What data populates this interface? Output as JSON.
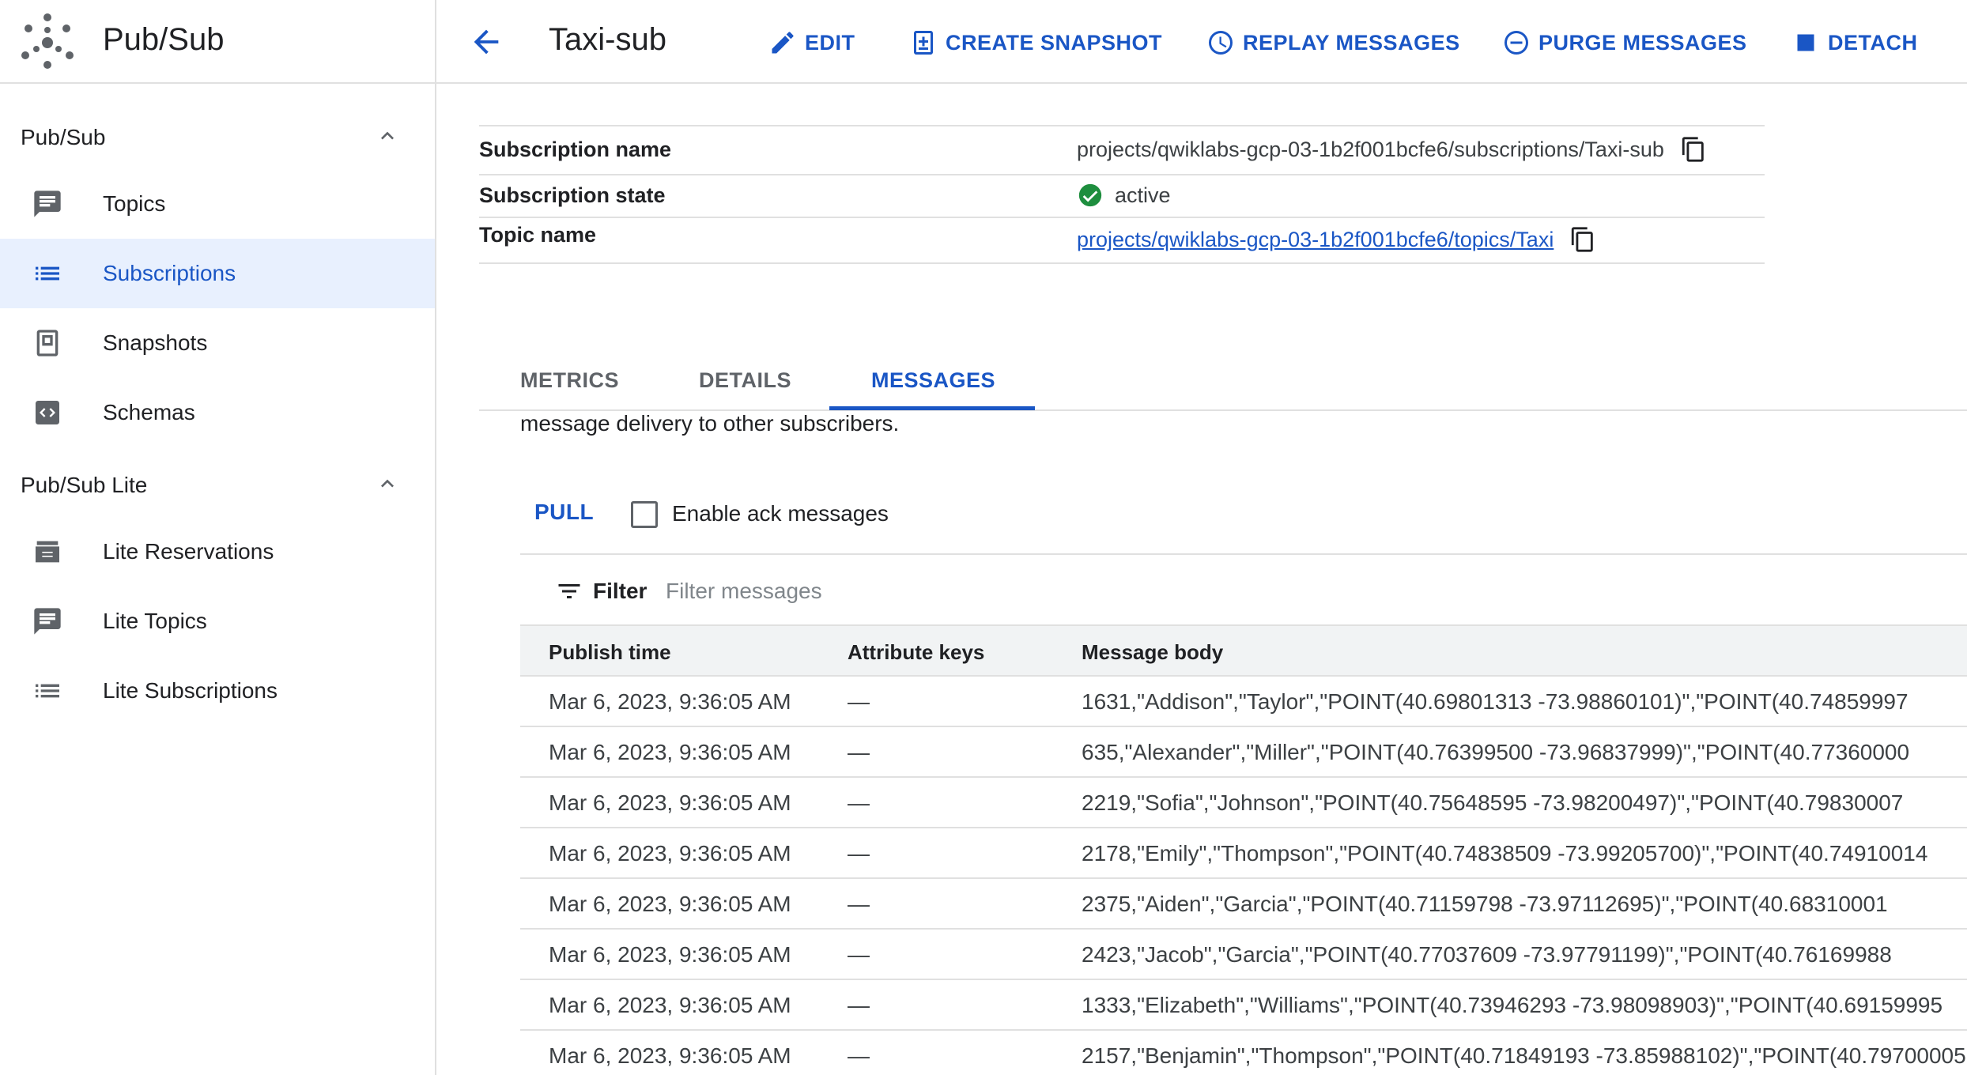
{
  "sidebar": {
    "product_title": "Pub/Sub",
    "sections": [
      {
        "label": "Pub/Sub",
        "items": [
          {
            "label": "Topics",
            "icon": "message-icon"
          },
          {
            "label": "Subscriptions",
            "icon": "list-icon",
            "active": true
          },
          {
            "label": "Snapshots",
            "icon": "snapshot-icon"
          },
          {
            "label": "Schemas",
            "icon": "schema-icon"
          }
        ]
      },
      {
        "label": "Pub/Sub Lite",
        "items": [
          {
            "label": "Lite Reservations",
            "icon": "reservation-icon"
          },
          {
            "label": "Lite Topics",
            "icon": "message-icon"
          },
          {
            "label": "Lite Subscriptions",
            "icon": "list-icon"
          }
        ]
      }
    ]
  },
  "header": {
    "title": "Taxi-sub",
    "actions": {
      "edit": "EDIT",
      "create_snapshot": "CREATE SNAPSHOT",
      "replay": "REPLAY MESSAGES",
      "purge": "PURGE MESSAGES",
      "detach": "DETACH"
    }
  },
  "info": {
    "subscription_name_label": "Subscription name",
    "subscription_name": "projects/qwiklabs-gcp-03-1b2f001bcfe6/subscriptions/Taxi-sub",
    "subscription_state_label": "Subscription state",
    "subscription_state": "active",
    "topic_name_label": "Topic name",
    "topic_name": "projects/qwiklabs-gcp-03-1b2f001bcfe6/topics/Taxi"
  },
  "tabs": {
    "metrics": "METRICS",
    "details": "DETAILS",
    "messages": "MESSAGES"
  },
  "messages_panel": {
    "description": "message delivery to other subscribers.",
    "pull_label": "PULL",
    "ack_label": "Enable ack messages",
    "filter_label": "Filter",
    "filter_placeholder": "Filter messages",
    "columns": {
      "publish_time": "Publish time",
      "attribute_keys": "Attribute keys",
      "message_body": "Message body"
    },
    "rows": [
      {
        "time": "Mar 6, 2023, 9:36:05 AM",
        "attrs": "—",
        "body": "1631,\"Addison\",\"Taylor\",\"POINT(40.69801313 -73.98860101)\",\"POINT(40.74859997"
      },
      {
        "time": "Mar 6, 2023, 9:36:05 AM",
        "attrs": "—",
        "body": "635,\"Alexander\",\"Miller\",\"POINT(40.76399500 -73.96837999)\",\"POINT(40.77360000"
      },
      {
        "time": "Mar 6, 2023, 9:36:05 AM",
        "attrs": "—",
        "body": "2219,\"Sofia\",\"Johnson\",\"POINT(40.75648595 -73.98200497)\",\"POINT(40.79830007"
      },
      {
        "time": "Mar 6, 2023, 9:36:05 AM",
        "attrs": "—",
        "body": "2178,\"Emily\",\"Thompson\",\"POINT(40.74838509 -73.99205700)\",\"POINT(40.74910014"
      },
      {
        "time": "Mar 6, 2023, 9:36:05 AM",
        "attrs": "—",
        "body": "2375,\"Aiden\",\"Garcia\",\"POINT(40.71159798 -73.97112695)\",\"POINT(40.68310001"
      },
      {
        "time": "Mar 6, 2023, 9:36:05 AM",
        "attrs": "—",
        "body": "2423,\"Jacob\",\"Garcia\",\"POINT(40.77037609 -73.97791199)\",\"POINT(40.76169988"
      },
      {
        "time": "Mar 6, 2023, 9:36:05 AM",
        "attrs": "—",
        "body": "1333,\"Elizabeth\",\"Williams\",\"POINT(40.73946293 -73.98098903)\",\"POINT(40.69159995"
      },
      {
        "time": "Mar 6, 2023, 9:36:05 AM",
        "attrs": "—",
        "body": "2157,\"Benjamin\",\"Thompson\",\"POINT(40.71849193 -73.85988102)\",\"POINT(40.79700005"
      }
    ]
  },
  "colors": {
    "accent": "#1a56c5",
    "active_bg": "#e8f0fe",
    "success": "#1e8e3e",
    "icon_gray": "#5f6368"
  }
}
